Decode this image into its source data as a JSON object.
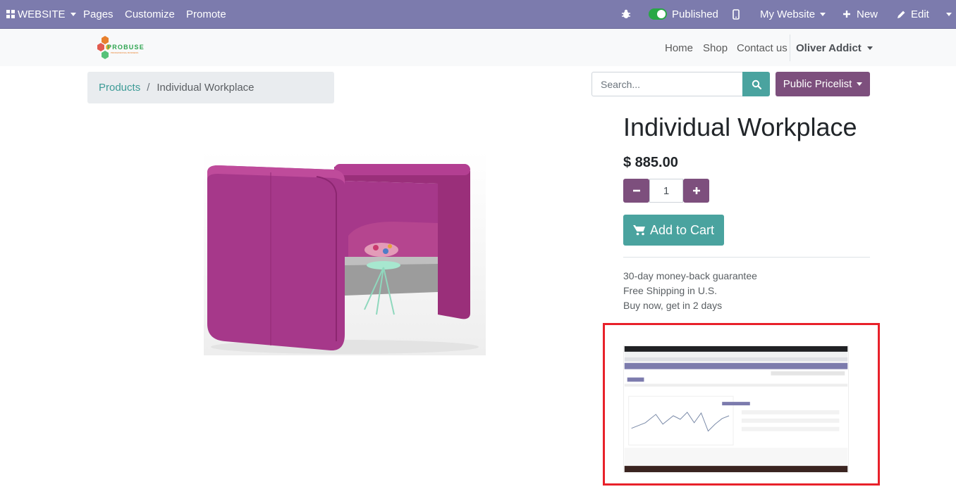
{
  "adminbar": {
    "apps_label": "WEBSITE",
    "pages": "Pages",
    "customize": "Customize",
    "promote": "Promote",
    "published": "Published",
    "my_website": "My Website",
    "new": "New",
    "edit": "Edit"
  },
  "header": {
    "logo_text": "PROBUSE",
    "logo_sub": "PROFESSIONAL BUSINESS",
    "nav": [
      "Home",
      "Shop",
      "Contact us"
    ],
    "user": "Oliver Addict"
  },
  "breadcrumb": {
    "parent": "Products",
    "separator": "/",
    "current": "Individual Workplace"
  },
  "search": {
    "placeholder": "Search..."
  },
  "pricelist": "Public Pricelist",
  "product": {
    "name": "Individual Workplace",
    "price": "$ 885.00",
    "quantity": "1",
    "add_to_cart": "Add to Cart",
    "terms": [
      "30-day money-back guarantee",
      "Free Shipping in U.S.",
      "Buy now, get in 2 days"
    ],
    "color": "#a63a86"
  },
  "colors": {
    "admin_bar": "#7c7bad",
    "primary": "#4aa39f",
    "secondary": "#7d4f7d",
    "highlight": "#e8212a"
  }
}
